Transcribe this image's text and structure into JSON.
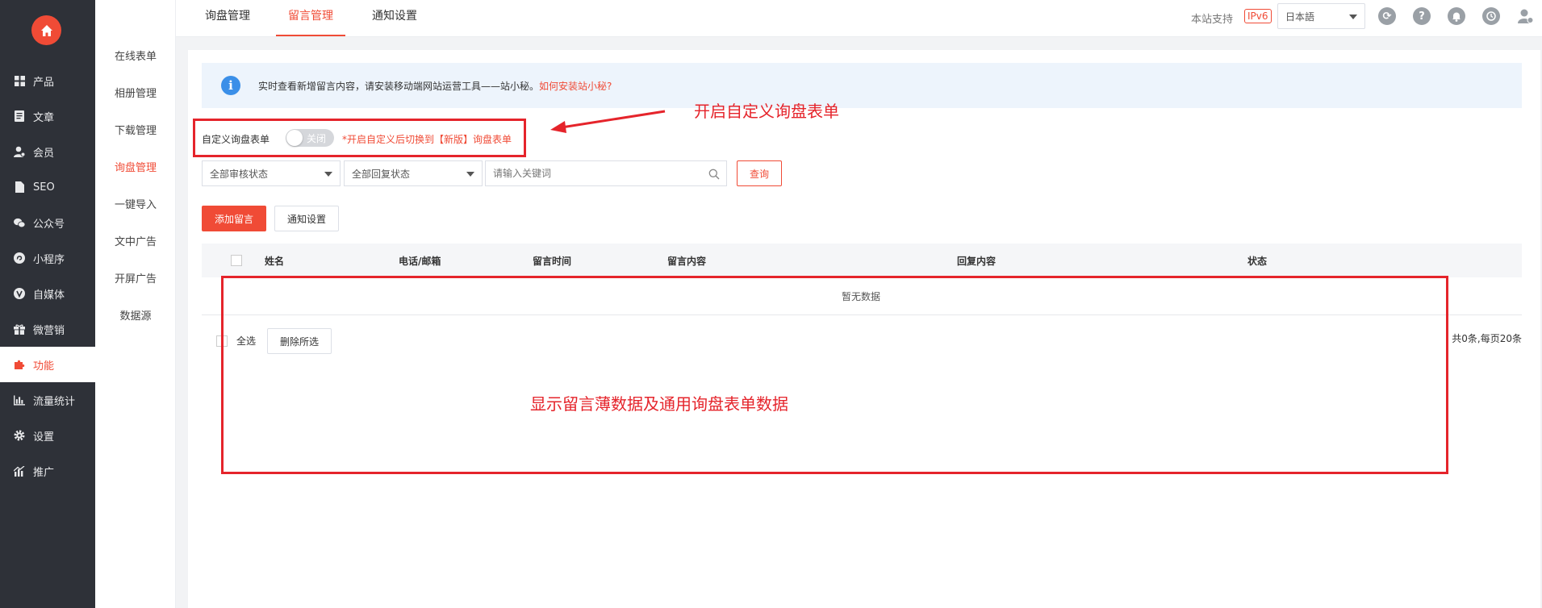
{
  "sidebar": {
    "items": [
      {
        "label": "产品",
        "icon": "grid-icon"
      },
      {
        "label": "文章",
        "icon": "document-icon"
      },
      {
        "label": "会员",
        "icon": "user-icon"
      },
      {
        "label": "SEO",
        "icon": "file-icon"
      },
      {
        "label": "公众号",
        "icon": "wechat-icon"
      },
      {
        "label": "小程序",
        "icon": "miniapp-icon"
      },
      {
        "label": "自媒体",
        "icon": "media-icon"
      },
      {
        "label": "微营销",
        "icon": "gift-icon"
      },
      {
        "label": "功能",
        "icon": "puzzle-icon"
      },
      {
        "label": "流量统计",
        "icon": "bar-chart-icon"
      },
      {
        "label": "设置",
        "icon": "gear-icon"
      },
      {
        "label": "推广",
        "icon": "promote-icon"
      }
    ]
  },
  "subnav": {
    "items": [
      "在线表单",
      "相册管理",
      "下载管理",
      "询盘管理",
      "一键导入",
      "文中广告",
      "开屏广告",
      "数据源"
    ]
  },
  "tabs": [
    "询盘管理",
    "留言管理",
    "通知设置"
  ],
  "topbar": {
    "support_text": "本站支持",
    "ipv6_badge": "IPv6",
    "language": "日本語"
  },
  "info": {
    "text": "实时查看新增留言内容，请安装移动端网站运营工具——站小秘。",
    "link": "如何安装站小秘?"
  },
  "custom_form": {
    "label": "自定义询盘表单",
    "toggle_text": "关闭",
    "hint": "*开启自定义后切换到【新版】询盘表单"
  },
  "filters": {
    "review_status": "全部审核状态",
    "reply_status": "全部回复状态",
    "search_placeholder": "请输入关键词",
    "query_button": "查询"
  },
  "actions": {
    "add_message": "添加留言",
    "notify_settings": "通知设置"
  },
  "table": {
    "columns": [
      "姓名",
      "电话/邮箱",
      "留言时间",
      "留言内容",
      "回复内容",
      "状态"
    ],
    "empty_text": "暂无数据"
  },
  "footer": {
    "select_all": "全选",
    "delete_selected": "删除所选",
    "pagination": "共0条,每页20条"
  },
  "annotations": {
    "enable_custom_form": "开启自定义询盘表单",
    "display_data": "显示留言薄数据及通用询盘表单数据"
  },
  "colors": {
    "accent": "#f04b36",
    "sidebar_bg": "#2e3138",
    "annotation_red": "#e5242b",
    "info_blue": "#3b8fe8"
  }
}
